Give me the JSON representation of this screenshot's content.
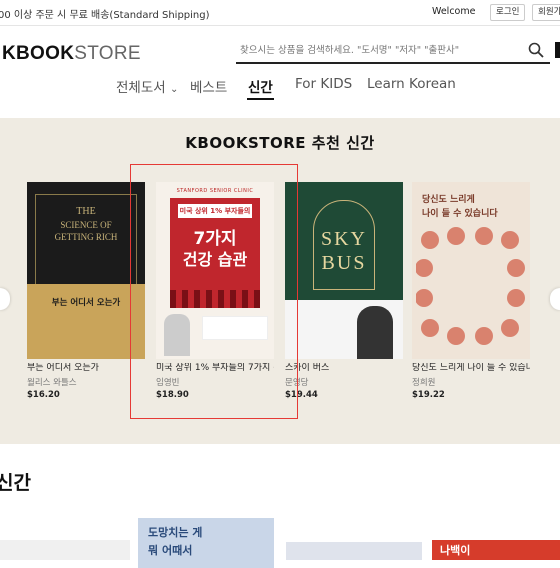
{
  "topbar": {
    "shipping_notice": "00 이상 주문 시 무료 배송(Standard Shipping)",
    "welcome": "Welcome",
    "login_label": "로그인",
    "signup_label": "회원가"
  },
  "header": {
    "logo_bold": "KBOOK",
    "logo_light": "STORE",
    "search_placeholder": "찾으시는 상품을 검색하세요. \"도서명\" \"저자\" \"출판사\""
  },
  "nav": {
    "items": [
      "전체도서",
      "베스트",
      "신간",
      "For KIDS",
      "Learn Korean"
    ],
    "active": "신간"
  },
  "recommend": {
    "title": "KBOOKSTORE 추천 신간",
    "books": [
      {
        "title": "부는 어디서 오는가",
        "author": "월리스 와틀스",
        "price": "$16.20",
        "cover_lines": [
          "THE",
          "SCIENCE OF",
          "GETTING RICH",
          "부는 어디서 오는가"
        ],
        "cover_color": "#1b1b1b"
      },
      {
        "title": "미국 상위 1% 부자들의 7가지 건강",
        "author": "임영빈",
        "price": "$18.90",
        "cover_lines": [
          "STANFORD SENIOR CLINIC",
          "미국 상위 1% 부자들의",
          "7가지",
          "건강 습관"
        ],
        "cover_color": "#c0262d"
      },
      {
        "title": "스카이 버스",
        "author": "문영당",
        "price": "$19.44",
        "cover_lines": [
          "SKY",
          "BUS"
        ],
        "cover_color": "#1f4a36"
      },
      {
        "title": "당신도 느리게 나이 들 수 있습니다",
        "author": "정희원",
        "price": "$19.22",
        "cover_lines": [
          "당신도 느리게",
          "나이 들 수 있습니다"
        ],
        "cover_color": "#e8ddd2"
      }
    ]
  },
  "new_section": {
    "title": "신간",
    "thumb_text": [
      "도망치는 게",
      "뭐 어때서"
    ],
    "thumb_text_right": "나백이"
  }
}
